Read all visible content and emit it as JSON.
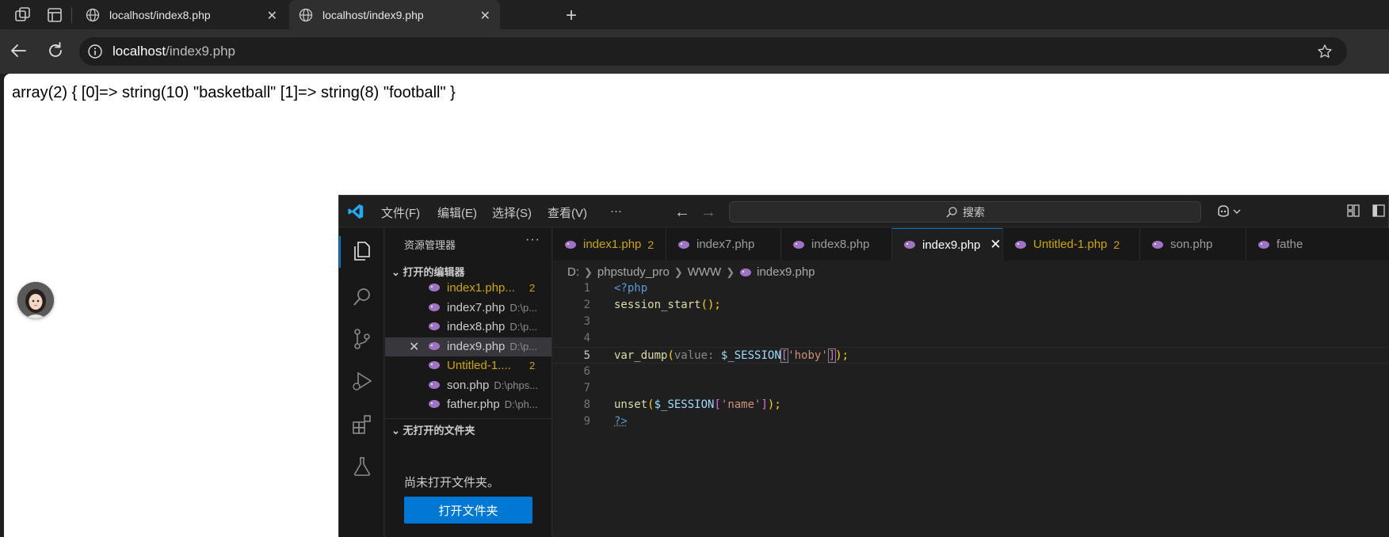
{
  "browser": {
    "tabs": [
      {
        "title": "localhost/index8.php",
        "active": false
      },
      {
        "title": "localhost/index9.php",
        "active": true
      }
    ],
    "address": {
      "host": "localhost",
      "path": "/index9.php"
    }
  },
  "page": {
    "output": "array(2) { [0]=> string(10) \"basketball\" [1]=> string(8) \"football\" }"
  },
  "vscode": {
    "menu": [
      "文件(F)",
      "编辑(E)",
      "选择(S)",
      "查看(V)",
      "···"
    ],
    "search_label": "搜索",
    "sidebar": {
      "title": "资源管理器",
      "more": "···",
      "open_editors_header": "打开的编辑器",
      "no_folder_header": "无打开的文件夹",
      "no_folder_text": "尚未打开文件夹。",
      "open_folder_button": "打开文件夹",
      "files": [
        {
          "name": "index1.php...",
          "path": "",
          "count": "2",
          "modified": true
        },
        {
          "name": "index7.php",
          "path": "D:\\p...",
          "count": "",
          "modified": false
        },
        {
          "name": "index8.php",
          "path": "D:\\p...",
          "count": "",
          "modified": false
        },
        {
          "name": "index9.php",
          "path": "D:\\p...",
          "count": "",
          "modified": false,
          "selected": true
        },
        {
          "name": "Untitled-1....",
          "path": "",
          "count": "2",
          "modified": true
        },
        {
          "name": "son.php",
          "path": "D:\\phps...",
          "count": "",
          "modified": false
        },
        {
          "name": "father.php",
          "path": "D:\\ph...",
          "count": "",
          "modified": false
        }
      ]
    },
    "editor_tabs": [
      {
        "name": "index1.php",
        "count": "2",
        "modified": true
      },
      {
        "name": "index7.php",
        "count": ""
      },
      {
        "name": "index8.php",
        "count": ""
      },
      {
        "name": "index9.php",
        "count": "",
        "active": true
      },
      {
        "name": "Untitled-1.php",
        "count": "2",
        "modified": true
      },
      {
        "name": "son.php",
        "count": ""
      },
      {
        "name": "fathe",
        "count": ""
      }
    ],
    "breadcrumb": [
      "D:",
      "phpstudy_pro",
      "WWW",
      "index9.php"
    ],
    "line_numbers": [
      "1",
      "2",
      "3",
      "4",
      "5",
      "6",
      "7",
      "8",
      "9"
    ],
    "code": {
      "l1": "<?php",
      "l2_fn": "session_start",
      "l2_rest": "();",
      "l5_fn": "var_dump",
      "l5_hint": "value: ",
      "l5_var": "$_SESSION",
      "l5_str": "'hoby'",
      "l5_end": ");",
      "l8_fn": "unset",
      "l8_var": "$_SESSION",
      "l8_str": "'name'",
      "l8_end": ");",
      "l9": "?>"
    }
  }
}
